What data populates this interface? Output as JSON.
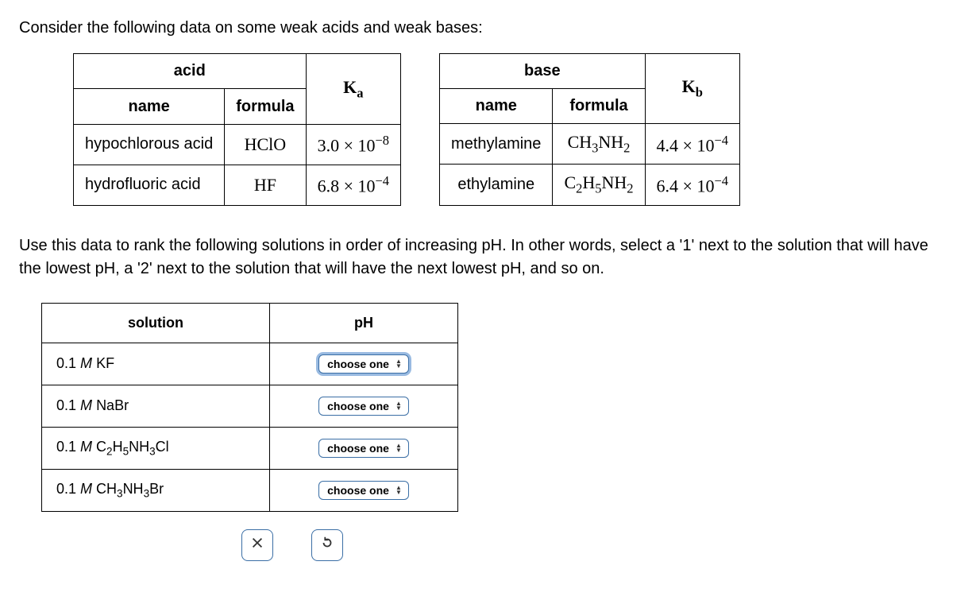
{
  "intro": "Consider the following data on some weak acids and weak bases:",
  "acid_table": {
    "group": "acid",
    "name_header": "name",
    "formula_header": "formula",
    "k_header": "K",
    "k_sub": "a",
    "rows": [
      {
        "name": "hypochlorous acid",
        "formula": "HClO",
        "k_mantissa": "3.0",
        "k_times": "×",
        "k_base": "10",
        "k_exp": "−8"
      },
      {
        "name": "hydrofluoric acid",
        "formula": "HF",
        "k_mantissa": "6.8",
        "k_times": "×",
        "k_base": "10",
        "k_exp": "−4"
      }
    ]
  },
  "base_table": {
    "group": "base",
    "name_header": "name",
    "formula_header": "formula",
    "k_header": "K",
    "k_sub": "b",
    "rows": [
      {
        "name": "methylamine",
        "formula_html": "CH3NH2",
        "k_mantissa": "4.4",
        "k_times": "×",
        "k_base": "10",
        "k_exp": "−4"
      },
      {
        "name": "ethylamine",
        "formula_html": "C2H5NH2",
        "k_mantissa": "6.4",
        "k_times": "×",
        "k_base": "10",
        "k_exp": "−4"
      }
    ]
  },
  "instructions": "Use this data to rank the following solutions in order of increasing pH. In other words, select a '1' next to the solution that will have the lowest pH, a '2' next to the solution that will have the next lowest pH, and so on.",
  "rank_table": {
    "solution_header": "solution",
    "ph_header": "pH",
    "chooser_label": "choose one",
    "rows": [
      {
        "conc": "0.1",
        "unit": "M",
        "name": "KF",
        "focused": true
      },
      {
        "conc": "0.1",
        "unit": "M",
        "name": "NaBr",
        "focused": false
      },
      {
        "conc": "0.1",
        "unit": "M",
        "name": "C2H5NH3Cl",
        "focused": false
      },
      {
        "conc": "0.1",
        "unit": "M",
        "name": "CH3NH3Br",
        "focused": false
      }
    ]
  },
  "buttons": {
    "clear": "clear",
    "reset": "reset"
  }
}
